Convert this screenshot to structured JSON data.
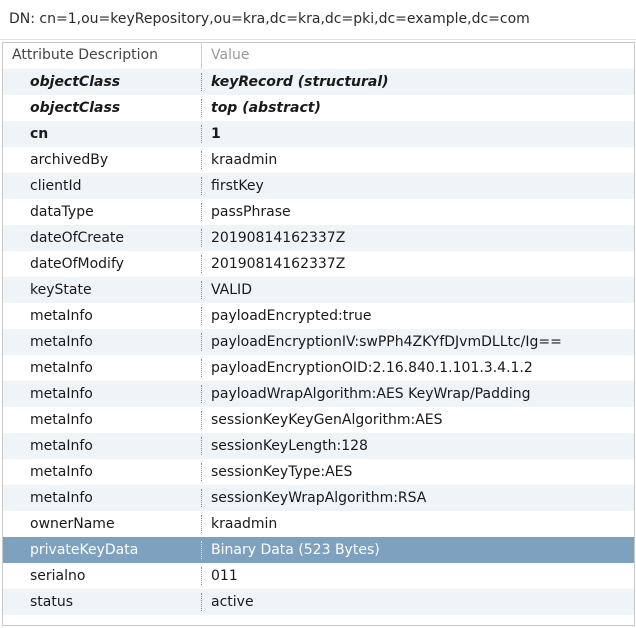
{
  "dn_bar": {
    "text": "DN: cn=1,ou=keyRepository,ou=kra,dc=kra,dc=pki,dc=example,dc=com"
  },
  "table": {
    "header_attribute": "Attribute Description",
    "header_value": "Value",
    "rows": [
      {
        "attribute": "objectClass",
        "value": "keyRecord (structural)"
      },
      {
        "attribute": "objectClass",
        "value": "top (abstract)"
      },
      {
        "attribute": "cn",
        "value": "1"
      },
      {
        "attribute": "archivedBy",
        "value": "kraadmin"
      },
      {
        "attribute": "clientId",
        "value": "firstKey"
      },
      {
        "attribute": "dataType",
        "value": "passPhrase"
      },
      {
        "attribute": "dateOfCreate",
        "value": "20190814162337Z"
      },
      {
        "attribute": "dateOfModify",
        "value": "20190814162337Z"
      },
      {
        "attribute": "keyState",
        "value": "VALID"
      },
      {
        "attribute": "metaInfo",
        "value": "payloadEncrypted:true"
      },
      {
        "attribute": "metaInfo",
        "value": "payloadEncryptionIV:swPPh4ZKYfDJvmDLLtc/Ig=="
      },
      {
        "attribute": "metaInfo",
        "value": "payloadEncryptionOID:2.16.840.1.101.3.4.1.2"
      },
      {
        "attribute": "metaInfo",
        "value": "payloadWrapAlgorithm:AES KeyWrap/Padding"
      },
      {
        "attribute": "metaInfo",
        "value": "sessionKeyKeyGenAlgorithm:AES"
      },
      {
        "attribute": "metaInfo",
        "value": "sessionKeyLength:128"
      },
      {
        "attribute": "metaInfo",
        "value": "sessionKeyType:AES"
      },
      {
        "attribute": "metaInfo",
        "value": "sessionKeyWrapAlgorithm:RSA"
      },
      {
        "attribute": "ownerName",
        "value": "kraadmin"
      },
      {
        "attribute": "privateKeyData",
        "value": "Binary Data (523 Bytes)"
      },
      {
        "attribute": "serialno",
        "value": "011"
      },
      {
        "attribute": "status",
        "value": "active"
      }
    ]
  },
  "colors": {
    "selected_row": "#7da1bf",
    "alt_row": "#eef4f8"
  }
}
